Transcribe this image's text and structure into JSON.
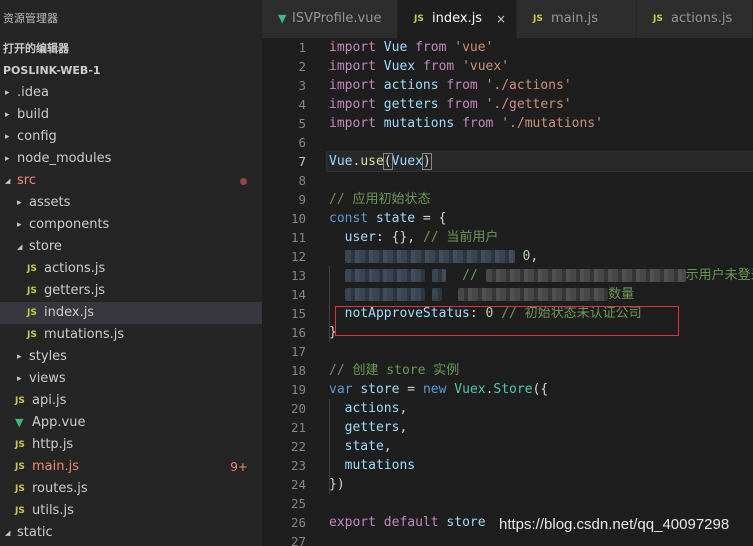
{
  "explorer": {
    "title": "资源管理器",
    "open_editors_label": "打开的编辑器",
    "project_label": "POSLINK-WEB-1",
    "tree": [
      {
        "label": ".idea",
        "type": "folder",
        "expanded": false,
        "depth": 0
      },
      {
        "label": "build",
        "type": "folder",
        "expanded": false,
        "depth": 0
      },
      {
        "label": "config",
        "type": "folder",
        "expanded": false,
        "depth": 0
      },
      {
        "label": "node_modules",
        "type": "folder",
        "expanded": false,
        "depth": 0
      },
      {
        "label": "src",
        "type": "folder",
        "expanded": true,
        "depth": 0,
        "status": "modified-dot"
      },
      {
        "label": "assets",
        "type": "folder",
        "expanded": false,
        "depth": 1
      },
      {
        "label": "components",
        "type": "folder",
        "expanded": false,
        "depth": 1
      },
      {
        "label": "store",
        "type": "folder",
        "expanded": true,
        "depth": 1
      },
      {
        "label": "actions.js",
        "type": "js",
        "depth": 2
      },
      {
        "label": "getters.js",
        "type": "js",
        "depth": 2
      },
      {
        "label": "index.js",
        "type": "js",
        "depth": 2,
        "active": true
      },
      {
        "label": "mutations.js",
        "type": "js",
        "depth": 2
      },
      {
        "label": "styles",
        "type": "folder",
        "expanded": false,
        "depth": 1
      },
      {
        "label": "views",
        "type": "folder",
        "expanded": false,
        "depth": 1
      },
      {
        "label": "api.js",
        "type": "js",
        "depth": 1
      },
      {
        "label": "App.vue",
        "type": "vue",
        "depth": 1
      },
      {
        "label": "http.js",
        "type": "js",
        "depth": 1
      },
      {
        "label": "main.js",
        "type": "js",
        "depth": 1,
        "status": "error",
        "badge": "9+"
      },
      {
        "label": "routes.js",
        "type": "js",
        "depth": 1
      },
      {
        "label": "utils.js",
        "type": "js",
        "depth": 1
      },
      {
        "label": "static",
        "type": "folder",
        "expanded": true,
        "depth": 0
      }
    ]
  },
  "tabs": [
    {
      "label": "ISVProfile.vue",
      "icon": "vue-icon",
      "active": false
    },
    {
      "label": "index.js",
      "icon": "js-icon",
      "active": true,
      "close": "×"
    },
    {
      "label": "main.js",
      "icon": "js-icon",
      "active": false
    },
    {
      "label": "actions.js",
      "icon": "js-icon",
      "active": false
    }
  ],
  "editor": {
    "current_line": 7,
    "lines": [
      {
        "n": "1",
        "tokens": [
          [
            "kw",
            "import"
          ],
          [
            "plain",
            " "
          ],
          [
            "var",
            "Vue"
          ],
          [
            "plain",
            " "
          ],
          [
            "kw",
            "from"
          ],
          [
            "plain",
            " "
          ],
          [
            "str",
            "'vue'"
          ]
        ]
      },
      {
        "n": "2",
        "tokens": [
          [
            "kw",
            "import"
          ],
          [
            "plain",
            " "
          ],
          [
            "var",
            "Vuex"
          ],
          [
            "plain",
            " "
          ],
          [
            "kw",
            "from"
          ],
          [
            "plain",
            " "
          ],
          [
            "str",
            "'vuex'"
          ]
        ]
      },
      {
        "n": "3",
        "tokens": [
          [
            "kw",
            "import"
          ],
          [
            "plain",
            " "
          ],
          [
            "var",
            "actions"
          ],
          [
            "plain",
            " "
          ],
          [
            "kw",
            "from"
          ],
          [
            "plain",
            " "
          ],
          [
            "str",
            "'./actions'"
          ]
        ]
      },
      {
        "n": "4",
        "tokens": [
          [
            "kw",
            "import"
          ],
          [
            "plain",
            " "
          ],
          [
            "var",
            "getters"
          ],
          [
            "plain",
            " "
          ],
          [
            "kw",
            "from"
          ],
          [
            "plain",
            " "
          ],
          [
            "str",
            "'./getters'"
          ]
        ]
      },
      {
        "n": "5",
        "tokens": [
          [
            "kw",
            "import"
          ],
          [
            "plain",
            " "
          ],
          [
            "var",
            "mutations"
          ],
          [
            "plain",
            " "
          ],
          [
            "kw",
            "from"
          ],
          [
            "plain",
            " "
          ],
          [
            "str",
            "'./mutations'"
          ]
        ]
      },
      {
        "n": "6",
        "tokens": []
      },
      {
        "n": "7",
        "tokens": [
          [
            "var",
            "Vue"
          ],
          [
            "plain",
            "."
          ],
          [
            "fn",
            "use"
          ],
          [
            "bracket",
            "("
          ],
          [
            "var",
            "Vuex"
          ],
          [
            "bracket",
            ")"
          ]
        ]
      },
      {
        "n": "8",
        "tokens": []
      },
      {
        "n": "9",
        "tokens": [
          [
            "cm",
            "// 应用初始状态"
          ]
        ]
      },
      {
        "n": "10",
        "tokens": [
          [
            "kw2",
            "const"
          ],
          [
            "plain",
            " "
          ],
          [
            "var",
            "state"
          ],
          [
            "plain",
            " = {"
          ]
        ]
      },
      {
        "n": "11",
        "tokens": [
          [
            "plain",
            "  "
          ],
          [
            "var",
            "user"
          ],
          [
            "plain",
            ": {}, "
          ],
          [
            "cm",
            "// 当前用户"
          ]
        ]
      },
      {
        "n": "12",
        "tokens": [
          [
            "plain",
            "  "
          ],
          [
            "blur",
            "170"
          ],
          [
            "plain",
            " "
          ],
          [
            "num",
            "0"
          ],
          [
            "plain",
            ","
          ]
        ]
      },
      {
        "n": "13",
        "tokens": [
          [
            "plain",
            "  "
          ],
          [
            "blur",
            "80"
          ],
          [
            "plain",
            " "
          ],
          [
            "blur",
            "14"
          ],
          [
            "plain",
            "  "
          ],
          [
            "cm",
            "// "
          ],
          [
            "blur",
            "200"
          ],
          [
            "cm",
            "示用户未登录"
          ]
        ]
      },
      {
        "n": "14",
        "tokens": [
          [
            "plain",
            "  "
          ],
          [
            "blur",
            "80"
          ],
          [
            "plain",
            " "
          ],
          [
            "blur",
            "10"
          ],
          [
            "plain",
            "  "
          ],
          [
            "blur",
            "150"
          ],
          [
            "cm",
            "数量"
          ]
        ]
      },
      {
        "n": "15",
        "tokens": [
          [
            "plain",
            "  "
          ],
          [
            "var",
            "notApproveStatus"
          ],
          [
            "plain",
            ": "
          ],
          [
            "num",
            "0"
          ],
          [
            "plain",
            " "
          ],
          [
            "cm",
            "// 初始状态未认证公司"
          ]
        ]
      },
      {
        "n": "16",
        "tokens": [
          [
            "plain",
            "}"
          ]
        ]
      },
      {
        "n": "17",
        "tokens": []
      },
      {
        "n": "18",
        "tokens": [
          [
            "cm",
            "// 创建 store 实例"
          ]
        ]
      },
      {
        "n": "19",
        "tokens": [
          [
            "kw2",
            "var"
          ],
          [
            "plain",
            " "
          ],
          [
            "var",
            "store"
          ],
          [
            "plain",
            " = "
          ],
          [
            "kw2",
            "new"
          ],
          [
            "plain",
            " "
          ],
          [
            "cls",
            "Vuex"
          ],
          [
            "plain",
            "."
          ],
          [
            "cls",
            "Store"
          ],
          [
            "plain",
            "({"
          ]
        ]
      },
      {
        "n": "20",
        "tokens": [
          [
            "plain",
            "  "
          ],
          [
            "var",
            "actions"
          ],
          [
            "plain",
            ","
          ]
        ]
      },
      {
        "n": "21",
        "tokens": [
          [
            "plain",
            "  "
          ],
          [
            "var",
            "getters"
          ],
          [
            "plain",
            ","
          ]
        ]
      },
      {
        "n": "22",
        "tokens": [
          [
            "plain",
            "  "
          ],
          [
            "var",
            "state"
          ],
          [
            "plain",
            ","
          ]
        ]
      },
      {
        "n": "23",
        "tokens": [
          [
            "plain",
            "  "
          ],
          [
            "var",
            "mutations"
          ]
        ]
      },
      {
        "n": "24",
        "tokens": [
          [
            "plain",
            "})"
          ]
        ]
      },
      {
        "n": "25",
        "tokens": []
      },
      {
        "n": "26",
        "tokens": [
          [
            "kw",
            "export"
          ],
          [
            "plain",
            " "
          ],
          [
            "kw",
            "default"
          ],
          [
            "plain",
            " "
          ],
          [
            "var",
            "store"
          ]
        ]
      },
      {
        "n": "27",
        "tokens": []
      }
    ]
  },
  "watermark": "https://blog.csdn.net/qq_40097298",
  "colors": {
    "keyword": "#c586c0",
    "storage": "#569cd6",
    "variable": "#9cdcfe",
    "string": "#ce9178",
    "comment": "#6a9955",
    "highlight_box": "#e0303a"
  }
}
